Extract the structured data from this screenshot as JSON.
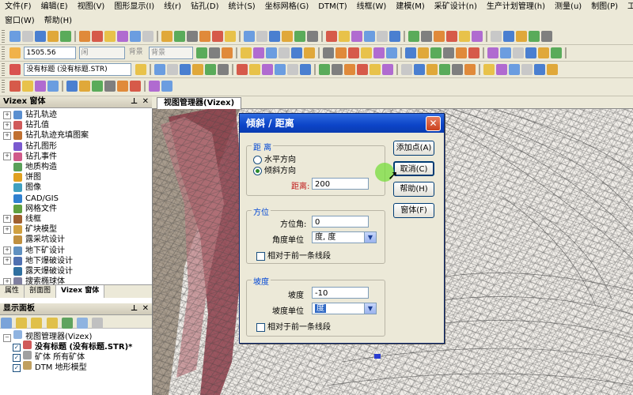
{
  "menu": {
    "row1": [
      "文件(F)",
      "编辑(E)",
      "视图(V)",
      "图形显示(I)",
      "线(r)",
      "钻孔(D)",
      "统计(S)",
      "坐标网格(G)",
      "DTM(T)",
      "线框(W)",
      "建模(M)",
      "采矿设计(n)",
      "生产计划管理(h)",
      "测量(u)",
      "制图(P)",
      "工具"
    ],
    "row2": [
      "窗口(W)",
      "帮助(H)"
    ]
  },
  "toolbar": {
    "value_field": "1505.56",
    "layer_placeholder": "闲",
    "bg_label": "背景",
    "bg_value": "背景",
    "title_combo": "没有标题 (没有标题.STR)"
  },
  "left_panel": {
    "title": "Vizex 窗体",
    "items": [
      "钻孔轨迹",
      "钻孔值",
      "钻孔轨迹充填图案",
      "钻孔图形",
      "钻孔事件",
      "地质构造",
      "饼图",
      "图像",
      "CAD/GIS",
      "网格文件",
      "线框",
      "矿块模型",
      "露采坑设计",
      "地下矿设计",
      "地下爆破设计",
      "露天爆破设计",
      "搜索椭球体"
    ],
    "tabs": [
      "属性",
      "剖面图",
      "Vizex 窗体"
    ]
  },
  "display_panel": {
    "title": "显示面板",
    "root": "视图管理器(Vizex)",
    "items": [
      "没有标题 (没有标题.STR)*",
      "矿体 所有矿体",
      "DTM 地形模型"
    ]
  },
  "view_tab": "视图管理器(Vizex)",
  "dialog": {
    "title": "倾斜 / 距离",
    "close": "✕",
    "distance": {
      "group_title": "距  离",
      "option_horizontal": "水平方向",
      "option_inclined": "倾斜方向",
      "label": "距离:",
      "value": "200"
    },
    "bearing": {
      "group_title": "方位",
      "label": "方位角:",
      "value": "0",
      "unit_label": "角度单位",
      "unit_value": "度, 度",
      "relative": "相对于前一条线段"
    },
    "slope": {
      "group_title": "坡度",
      "label": "坡度",
      "value": "-10",
      "unit_label": "坡度单位",
      "unit_value": "度",
      "relative": "相对于前一条线段"
    },
    "buttons": {
      "add_point": "添加点(A)",
      "cancel": "取消(C)",
      "help": "帮助(H)",
      "window": "窗体(F)"
    }
  },
  "colors": {
    "title_bar": "#0c44c8",
    "accent": "#316ac5",
    "terrain_red": "#8a3c48"
  }
}
